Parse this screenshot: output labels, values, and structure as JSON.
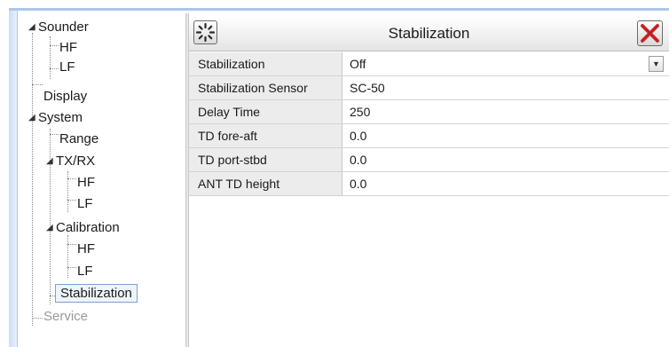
{
  "tree": {
    "sounder": "Sounder",
    "sounder_hf": "HF",
    "sounder_lf": "LF",
    "display": "Display",
    "system": "System",
    "range": "Range",
    "txrx": "TX/RX",
    "txrx_hf": "HF",
    "txrx_lf": "LF",
    "calibration": "Calibration",
    "calibration_hf": "HF",
    "calibration_lf": "LF",
    "stabilization": "Stabilization",
    "service": "Service",
    "expand_glyph": "◢",
    "selected": "Stabilization"
  },
  "dialog": {
    "title": "Stabilization",
    "spinner_icon": "spinner-icon",
    "close_icon": "close-icon",
    "close_color": "#d42a2a"
  },
  "settings": [
    {
      "name": "Stabilization",
      "value": "Off",
      "has_dropdown": true
    },
    {
      "name": "Stabilization Sensor",
      "value": "SC-50"
    },
    {
      "name": "Delay Time",
      "value": "250"
    },
    {
      "name": "TD fore-aft",
      "value": "0.0"
    },
    {
      "name": "TD port-stbd",
      "value": "0.0"
    },
    {
      "name": "ANT TD height",
      "value": "0.0"
    }
  ],
  "dropdown_glyph": "▼"
}
